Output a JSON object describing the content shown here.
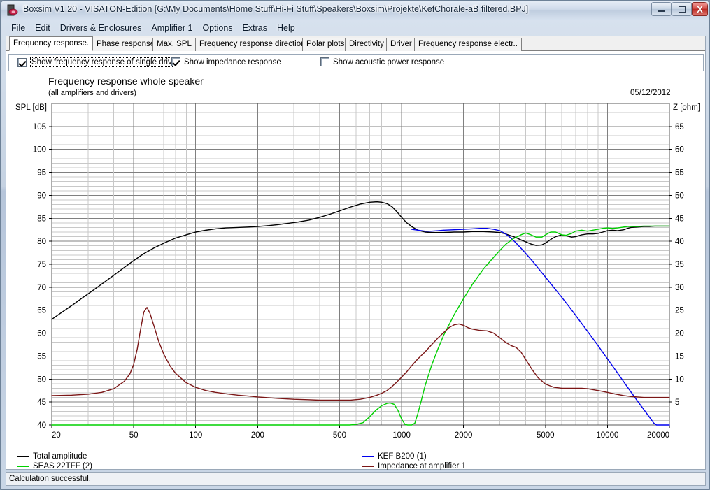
{
  "window": {
    "title": "Boxsim V1.20 - VISATON-Edition [G:\\My Documents\\Home Stuff\\Hi-Fi Stuff\\Speakers\\Boxsim\\Projekte\\KefChorale-aB filtered.BPJ]",
    "icon": "boxsim-app-icon",
    "buttons": {
      "minimize": "–",
      "maximize": "□",
      "close": "X"
    }
  },
  "menu": {
    "items": [
      {
        "label": "File"
      },
      {
        "label": "Edit"
      },
      {
        "label": "Drivers & Enclosures"
      },
      {
        "label": "Amplifier 1"
      },
      {
        "label": "Options"
      },
      {
        "label": "Extras"
      },
      {
        "label": "Help"
      }
    ]
  },
  "tabs": [
    {
      "label": "Frequency response.",
      "active": true
    },
    {
      "label": "Phase response",
      "active": false
    },
    {
      "label": "Max. SPL",
      "active": false
    },
    {
      "label": "Frequency response directions",
      "active": false
    },
    {
      "label": "Polar plots",
      "active": false
    },
    {
      "label": "Directivity",
      "active": false
    },
    {
      "label": "Driver",
      "active": false
    },
    {
      "label": "Frequency response electr..",
      "active": false
    }
  ],
  "options": [
    {
      "label": "Show frequency response of single drive",
      "checked": true,
      "focused": true
    },
    {
      "label": "Show impedance response",
      "checked": true,
      "focused": false
    },
    {
      "label": "Show acoustic power response",
      "checked": false,
      "focused": false
    }
  ],
  "status": {
    "message": "Calculation successful."
  },
  "chart_data": {
    "type": "line",
    "title": "Frequency response whole speaker",
    "subtitle": "(all amplifiers and drivers)",
    "date": "05/12/2012",
    "xlabel": "",
    "ylabel": "SPL [dB]",
    "y2label": "Z [ohm]",
    "xscale": "log",
    "xlim": [
      20,
      20000
    ],
    "xticks": [
      20,
      50,
      100,
      200,
      500,
      1000,
      2000,
      5000,
      10000,
      20000
    ],
    "xticklabels": [
      "20",
      "50",
      "100",
      "200",
      "500",
      "1000",
      "2000",
      "5000",
      "10000",
      "20000"
    ],
    "ylim": [
      40,
      110
    ],
    "yticks": [
      40,
      45,
      50,
      55,
      60,
      65,
      70,
      75,
      80,
      85,
      90,
      95,
      100,
      105
    ],
    "yticklabels": [
      "40",
      "45",
      "50",
      "55",
      "60",
      "65",
      "70",
      "75",
      "80",
      "85",
      "90",
      "95",
      "100",
      "105"
    ],
    "y2lim": [
      0,
      70
    ],
    "y2ticks": [
      5,
      10,
      15,
      20,
      25,
      30,
      35,
      40,
      45,
      50,
      55,
      60,
      65
    ],
    "y2ticklabels": [
      "5",
      "10",
      "15",
      "20",
      "25",
      "30",
      "35",
      "40",
      "45",
      "50",
      "55",
      "60",
      "65"
    ],
    "grid": true,
    "legend_position": "below",
    "series": [
      {
        "name": "Total amplitude",
        "color": "#000000",
        "axis": "left",
        "units": "dB",
        "points": [
          [
            20,
            63.0
          ],
          [
            22,
            64.3
          ],
          [
            25,
            66.0
          ],
          [
            28,
            67.6
          ],
          [
            31.5,
            69.2
          ],
          [
            35,
            70.7
          ],
          [
            40,
            72.6
          ],
          [
            45,
            74.3
          ],
          [
            50,
            75.8
          ],
          [
            56,
            77.3
          ],
          [
            63,
            78.6
          ],
          [
            71,
            79.7
          ],
          [
            80,
            80.7
          ],
          [
            90,
            81.4
          ],
          [
            100,
            82.0
          ],
          [
            112,
            82.4
          ],
          [
            125,
            82.7
          ],
          [
            140,
            82.9
          ],
          [
            160,
            83.0
          ],
          [
            180,
            83.1
          ],
          [
            200,
            83.2
          ],
          [
            225,
            83.4
          ],
          [
            250,
            83.6
          ],
          [
            280,
            83.9
          ],
          [
            315,
            84.2
          ],
          [
            355,
            84.6
          ],
          [
            400,
            85.2
          ],
          [
            450,
            85.9
          ],
          [
            500,
            86.6
          ],
          [
            560,
            87.4
          ],
          [
            630,
            88.1
          ],
          [
            700,
            88.5
          ],
          [
            760,
            88.6
          ],
          [
            800,
            88.5
          ],
          [
            850,
            88.2
          ],
          [
            900,
            87.5
          ],
          [
            950,
            86.4
          ],
          [
            1000,
            85.2
          ],
          [
            1060,
            84.0
          ],
          [
            1120,
            83.2
          ],
          [
            1200,
            82.4
          ],
          [
            1300,
            82.0
          ],
          [
            1400,
            81.9
          ],
          [
            1500,
            81.9
          ],
          [
            1600,
            81.9
          ],
          [
            1800,
            82.0
          ],
          [
            2000,
            82.0
          ],
          [
            2200,
            82.1
          ],
          [
            2500,
            82.1
          ],
          [
            2800,
            82.0
          ],
          [
            3000,
            81.9
          ],
          [
            3200,
            81.6
          ],
          [
            3500,
            81.0
          ],
          [
            3800,
            80.3
          ],
          [
            4000,
            79.9
          ],
          [
            4250,
            79.4
          ],
          [
            4500,
            79.1
          ],
          [
            4800,
            79.2
          ],
          [
            5000,
            79.6
          ],
          [
            5300,
            80.4
          ],
          [
            5600,
            81.0
          ],
          [
            6000,
            81.4
          ],
          [
            6300,
            81.2
          ],
          [
            6700,
            80.9
          ],
          [
            7000,
            81.0
          ],
          [
            7500,
            81.4
          ],
          [
            8000,
            81.6
          ],
          [
            8500,
            81.6
          ],
          [
            9000,
            81.7
          ],
          [
            9500,
            82.0
          ],
          [
            10000,
            82.3
          ],
          [
            10600,
            82.4
          ],
          [
            11200,
            82.3
          ],
          [
            12000,
            82.5
          ],
          [
            12500,
            82.8
          ],
          [
            13000,
            83.0
          ],
          [
            14000,
            83.1
          ],
          [
            15000,
            83.2
          ],
          [
            16000,
            83.2
          ],
          [
            17000,
            83.3
          ],
          [
            18000,
            83.3
          ],
          [
            19000,
            83.3
          ],
          [
            20000,
            83.3
          ]
        ]
      },
      {
        "name": "KEF B200 (1)",
        "color": "#0000ee",
        "axis": "left",
        "units": "dB",
        "points": [
          [
            1120,
            82.6
          ],
          [
            1200,
            82.4
          ],
          [
            1300,
            82.2
          ],
          [
            1400,
            82.2
          ],
          [
            1500,
            82.3
          ],
          [
            1600,
            82.4
          ],
          [
            1800,
            82.5
          ],
          [
            2000,
            82.6
          ],
          [
            2200,
            82.7
          ],
          [
            2400,
            82.8
          ],
          [
            2600,
            82.8
          ],
          [
            2800,
            82.6
          ],
          [
            3000,
            82.3
          ],
          [
            3200,
            81.6
          ],
          [
            3400,
            80.7
          ],
          [
            3600,
            79.6
          ],
          [
            3800,
            78.5
          ],
          [
            4000,
            77.4
          ],
          [
            4300,
            75.8
          ],
          [
            4600,
            74.2
          ],
          [
            5000,
            72.2
          ],
          [
            5500,
            69.9
          ],
          [
            6000,
            67.8
          ],
          [
            6500,
            65.8
          ],
          [
            7000,
            63.9
          ],
          [
            7500,
            62.1
          ],
          [
            8000,
            60.4
          ],
          [
            8500,
            58.8
          ],
          [
            9000,
            57.3
          ],
          [
            9500,
            55.8
          ],
          [
            10000,
            54.4
          ],
          [
            11000,
            51.8
          ],
          [
            12000,
            49.4
          ],
          [
            13000,
            47.2
          ],
          [
            14000,
            45.2
          ],
          [
            15000,
            43.4
          ],
          [
            16000,
            41.7
          ],
          [
            16800,
            40.4
          ],
          [
            17300,
            40.0
          ],
          [
            20000,
            40.0
          ]
        ]
      },
      {
        "name": "SEAS 22TFF (2)",
        "color": "#00d000",
        "axis": "left",
        "units": "dB",
        "points": [
          [
            20,
            40.0
          ],
          [
            400,
            40.0
          ],
          [
            560,
            40.0
          ],
          [
            600,
            40.1
          ],
          [
            650,
            40.5
          ],
          [
            700,
            41.8
          ],
          [
            750,
            43.2
          ],
          [
            800,
            44.2
          ],
          [
            850,
            44.7
          ],
          [
            880,
            44.8
          ],
          [
            920,
            44.5
          ],
          [
            960,
            43.2
          ],
          [
            1000,
            41.3
          ],
          [
            1040,
            40.1
          ],
          [
            1070,
            40.0
          ],
          [
            1120,
            40.0
          ],
          [
            1160,
            40.4
          ],
          [
            1200,
            42.5
          ],
          [
            1250,
            45.5
          ],
          [
            1300,
            48.5
          ],
          [
            1400,
            53.0
          ],
          [
            1500,
            56.5
          ],
          [
            1600,
            59.5
          ],
          [
            1800,
            64.0
          ],
          [
            2000,
            67.5
          ],
          [
            2200,
            70.5
          ],
          [
            2500,
            74.0
          ],
          [
            2800,
            76.5
          ],
          [
            3000,
            78.0
          ],
          [
            3200,
            79.3
          ],
          [
            3500,
            80.6
          ],
          [
            3800,
            81.4
          ],
          [
            4000,
            81.8
          ],
          [
            4200,
            81.5
          ],
          [
            4500,
            80.9
          ],
          [
            4800,
            80.9
          ],
          [
            5000,
            81.4
          ],
          [
            5300,
            82.0
          ],
          [
            5600,
            82.0
          ],
          [
            6000,
            81.4
          ],
          [
            6300,
            81.3
          ],
          [
            6700,
            81.7
          ],
          [
            7000,
            82.2
          ],
          [
            7500,
            82.4
          ],
          [
            8000,
            82.2
          ],
          [
            8500,
            82.4
          ],
          [
            9000,
            82.6
          ],
          [
            9500,
            82.8
          ],
          [
            10000,
            82.9
          ],
          [
            10600,
            82.8
          ],
          [
            11200,
            82.9
          ],
          [
            12000,
            83.1
          ],
          [
            12500,
            83.2
          ],
          [
            13000,
            83.2
          ],
          [
            14000,
            83.2
          ],
          [
            15000,
            83.3
          ],
          [
            16000,
            83.3
          ],
          [
            18000,
            83.3
          ],
          [
            20000,
            83.3
          ]
        ]
      },
      {
        "name": "Impedance at amplifier 1",
        "color": "#7b1616",
        "axis": "right",
        "units": "ohm",
        "points": [
          [
            20,
            6.4
          ],
          [
            25,
            6.5
          ],
          [
            30,
            6.7
          ],
          [
            35,
            7.1
          ],
          [
            40,
            7.9
          ],
          [
            45,
            9.5
          ],
          [
            48,
            11.2
          ],
          [
            50,
            13.2
          ],
          [
            52,
            16.5
          ],
          [
            54,
            20.8
          ],
          [
            56,
            24.6
          ],
          [
            58,
            25.6
          ],
          [
            60,
            24.3
          ],
          [
            63,
            21.3
          ],
          [
            66,
            18.3
          ],
          [
            70,
            15.4
          ],
          [
            75,
            12.9
          ],
          [
            80,
            11.2
          ],
          [
            90,
            9.2
          ],
          [
            100,
            8.2
          ],
          [
            112,
            7.5
          ],
          [
            125,
            7.1
          ],
          [
            140,
            6.8
          ],
          [
            160,
            6.5
          ],
          [
            180,
            6.3
          ],
          [
            200,
            6.1
          ],
          [
            250,
            5.8
          ],
          [
            300,
            5.6
          ],
          [
            350,
            5.5
          ],
          [
            400,
            5.4
          ],
          [
            450,
            5.4
          ],
          [
            500,
            5.4
          ],
          [
            560,
            5.4
          ],
          [
            630,
            5.6
          ],
          [
            700,
            6.0
          ],
          [
            760,
            6.5
          ],
          [
            800,
            6.9
          ],
          [
            850,
            7.5
          ],
          [
            900,
            8.4
          ],
          [
            950,
            9.4
          ],
          [
            1000,
            10.4
          ],
          [
            1060,
            11.6
          ],
          [
            1120,
            12.9
          ],
          [
            1200,
            14.4
          ],
          [
            1300,
            15.9
          ],
          [
            1400,
            17.5
          ],
          [
            1500,
            18.9
          ],
          [
            1600,
            20.1
          ],
          [
            1700,
            21.2
          ],
          [
            1800,
            21.8
          ],
          [
            1900,
            22.0
          ],
          [
            2000,
            21.7
          ],
          [
            2100,
            21.2
          ],
          [
            2200,
            20.9
          ],
          [
            2400,
            20.6
          ],
          [
            2600,
            20.5
          ],
          [
            2800,
            20.0
          ],
          [
            3000,
            19.0
          ],
          [
            3200,
            18.0
          ],
          [
            3400,
            17.3
          ],
          [
            3600,
            16.9
          ],
          [
            3800,
            15.9
          ],
          [
            4000,
            14.3
          ],
          [
            4300,
            12.1
          ],
          [
            4600,
            10.3
          ],
          [
            5000,
            8.9
          ],
          [
            5500,
            8.2
          ],
          [
            6000,
            8.0
          ],
          [
            6500,
            8.0
          ],
          [
            7000,
            8.0
          ],
          [
            7500,
            8.0
          ],
          [
            8000,
            7.9
          ],
          [
            8500,
            7.7
          ],
          [
            9000,
            7.5
          ],
          [
            10000,
            7.1
          ],
          [
            11000,
            6.7
          ],
          [
            12000,
            6.4
          ],
          [
            13000,
            6.2
          ],
          [
            14000,
            6.1
          ],
          [
            15000,
            6.0
          ],
          [
            16000,
            6.0
          ],
          [
            18000,
            6.0
          ],
          [
            20000,
            6.0
          ]
        ]
      }
    ]
  }
}
